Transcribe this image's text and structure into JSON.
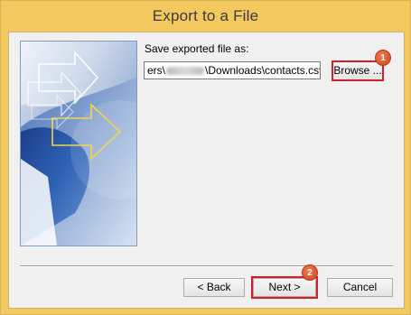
{
  "window": {
    "title": "Export to a File"
  },
  "form": {
    "save_label": "Save exported file as:",
    "path_prefix": "ers\\",
    "path_suffix": "\\Downloads\\contacts.csv",
    "browse_label": "Browse ..."
  },
  "footer": {
    "back_label": "< Back",
    "next_label": "Next >",
    "cancel_label": "Cancel"
  },
  "annotations": {
    "step1": "1",
    "step2": "2",
    "highlight_color": "#d0202a",
    "badge_color": "#e0562b"
  },
  "colors": {
    "titlebar": "#f3c85e",
    "client_bg": "#f0f0f0",
    "image_blue": "#1f4e9c"
  }
}
